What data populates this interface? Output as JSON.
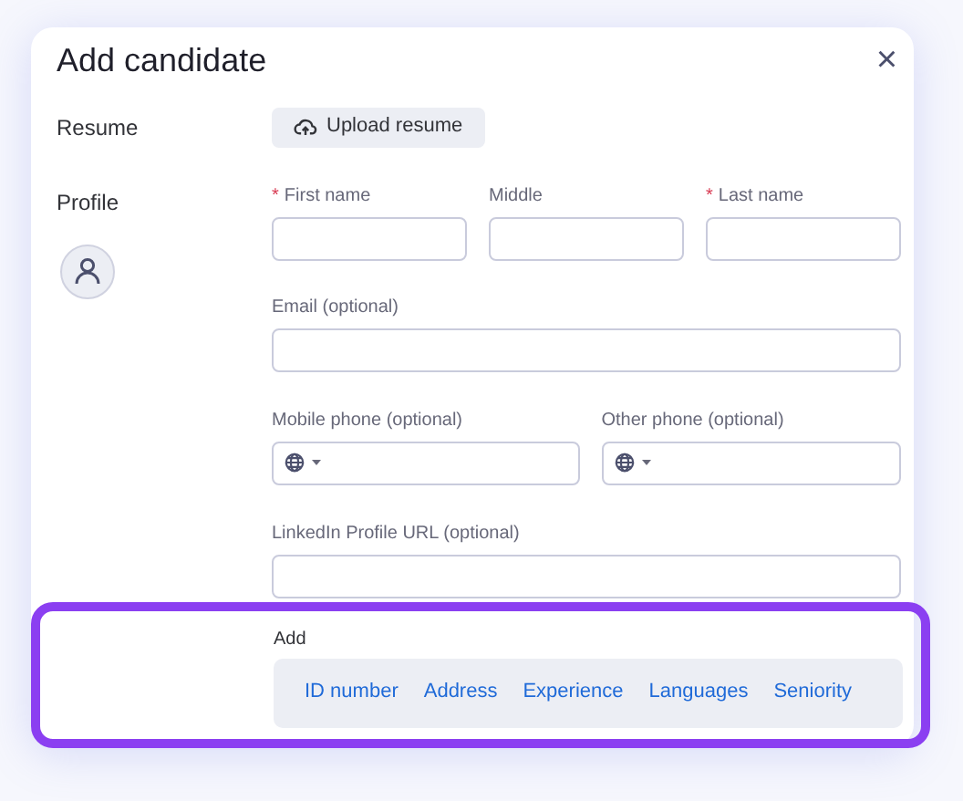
{
  "dialog": {
    "title": "Add candidate",
    "close": "×"
  },
  "resume": {
    "label": "Resume",
    "button": "Upload resume"
  },
  "profile": {
    "label": "Profile"
  },
  "required_mark": "*",
  "name_fields": [
    {
      "label": "First name",
      "required": true
    },
    {
      "label": "Middle",
      "required": false
    },
    {
      "label": "Last name",
      "required": true
    }
  ],
  "email": {
    "label": "Email (optional)"
  },
  "phones": [
    {
      "label": "Mobile phone (optional)"
    },
    {
      "label": "Other phone (optional)"
    }
  ],
  "linkedin": {
    "label": "LinkedIn Profile URL (optional)"
  },
  "add": {
    "label": "Add",
    "highlighted": true,
    "links": [
      "ID number",
      "Address",
      "Experience",
      "Languages",
      "Seniority"
    ]
  }
}
